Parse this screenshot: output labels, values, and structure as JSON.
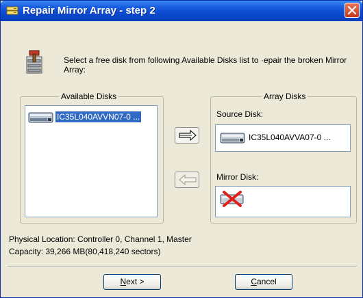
{
  "window": {
    "title": "Repair Mirror Array - step 2"
  },
  "instruction": "Select a free disk from following Available Disks list to ·epair the broken Mirror Array:",
  "available_disks": {
    "label": "Available Disks",
    "items": [
      {
        "label": "IC35L040AVVN07-0 ...",
        "selected": true
      }
    ]
  },
  "array_disks": {
    "label": "Array Disks",
    "source_label": "Source Disk:",
    "source_value": "IC35L040AVVA07-0 ...",
    "mirror_label": "Mirror Disk:",
    "mirror_status": "empty"
  },
  "info": {
    "location": "Physical Location: Controller 0, Channel 1, Master",
    "capacity": "Capacity: 39,266 MB(80,418,240 sectors)"
  },
  "buttons": {
    "next_mnemonic": "N",
    "next_rest": "ext >",
    "cancel_mnemonic": "C",
    "cancel_rest": "ancel"
  },
  "icons": {
    "title": "disk-array-icon",
    "close": "close-icon",
    "header": "repair-tool-icon",
    "disk": "hard-disk-icon",
    "add": "arrow-right-icon",
    "remove": "arrow-left-icon",
    "missing": "red-x-icon"
  },
  "colors": {
    "titlebar": "#0a4ad0",
    "selection": "#316ac5",
    "window_bg": "#ece9d8"
  }
}
